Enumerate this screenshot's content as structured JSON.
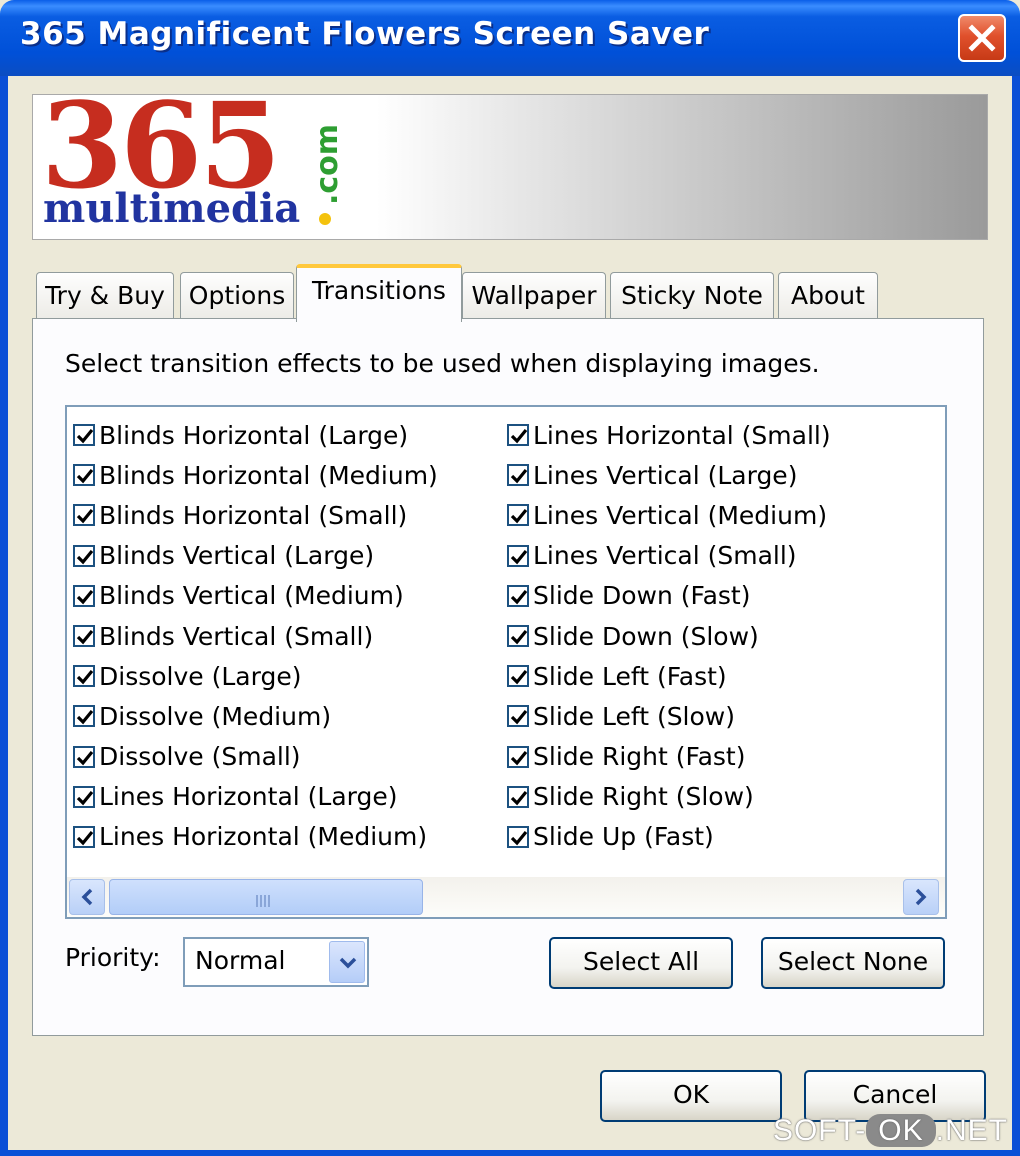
{
  "window": {
    "title": "365 Magnificent Flowers Screen Saver"
  },
  "banner": {
    "logo_number": "365",
    "logo_word": "multimedia",
    "logo_suffix": ".com"
  },
  "tabs": [
    {
      "label": "Try & Buy",
      "active": false
    },
    {
      "label": "Options",
      "active": false
    },
    {
      "label": "Transitions",
      "active": true
    },
    {
      "label": "Wallpaper",
      "active": false
    },
    {
      "label": "Sticky Note",
      "active": false
    },
    {
      "label": "About",
      "active": false
    }
  ],
  "transitions": {
    "instruction": "Select transition effects to be used when displaying images.",
    "left_items": [
      {
        "label": "Blinds Horizontal (Large)",
        "checked": true
      },
      {
        "label": "Blinds Horizontal (Medium)",
        "checked": true
      },
      {
        "label": "Blinds Horizontal (Small)",
        "checked": true
      },
      {
        "label": "Blinds Vertical (Large)",
        "checked": true
      },
      {
        "label": "Blinds Vertical (Medium)",
        "checked": true
      },
      {
        "label": "Blinds Vertical (Small)",
        "checked": true
      },
      {
        "label": "Dissolve (Large)",
        "checked": true
      },
      {
        "label": "Dissolve (Medium)",
        "checked": true
      },
      {
        "label": "Dissolve (Small)",
        "checked": true
      },
      {
        "label": "Lines Horizontal (Large)",
        "checked": true
      },
      {
        "label": "Lines Horizontal (Medium)",
        "checked": true
      }
    ],
    "right_items": [
      {
        "label": "Lines Horizontal (Small)",
        "checked": true
      },
      {
        "label": "Lines Vertical (Large)",
        "checked": true
      },
      {
        "label": "Lines Vertical (Medium)",
        "checked": true
      },
      {
        "label": "Lines Vertical (Small)",
        "checked": true
      },
      {
        "label": "Slide Down (Fast)",
        "checked": true
      },
      {
        "label": "Slide Down (Slow)",
        "checked": true
      },
      {
        "label": "Slide Left (Fast)",
        "checked": true
      },
      {
        "label": "Slide Left (Slow)",
        "checked": true
      },
      {
        "label": "Slide Right (Fast)",
        "checked": true
      },
      {
        "label": "Slide Right (Slow)",
        "checked": true
      },
      {
        "label": "Slide Up (Fast)",
        "checked": true
      }
    ],
    "priority_label": "Priority:",
    "priority_value": "Normal",
    "select_all_label": "Select All",
    "select_none_label": "Select None"
  },
  "footer": {
    "ok_label": "OK",
    "cancel_label": "Cancel"
  },
  "watermark": {
    "left": "SOFT-",
    "mid": "OK",
    "right": ".NET"
  },
  "colors": {
    "title_bar": "#0050d8",
    "logo_red": "#c62d1f",
    "logo_blue": "#2134a0",
    "logo_green": "#2e9e32",
    "dialog_bg": "#ece9d8"
  }
}
